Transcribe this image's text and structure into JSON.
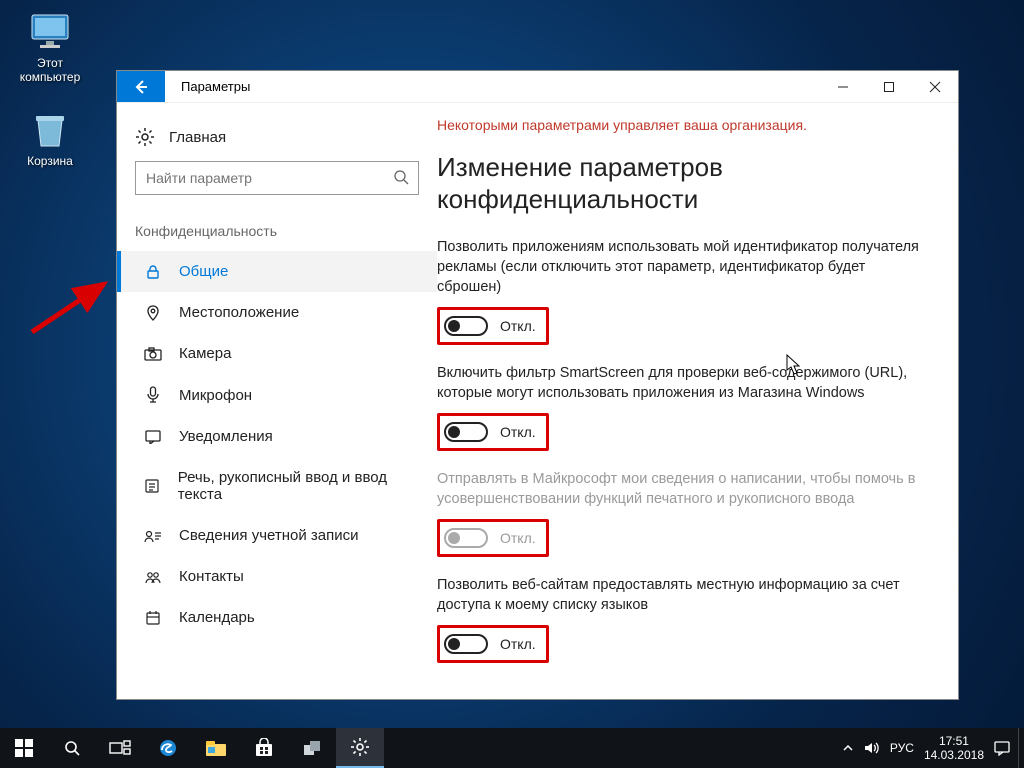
{
  "desktop": {
    "icons": [
      {
        "name": "this-pc",
        "label": "Этот\nкомпьютер"
      },
      {
        "name": "recycle-bin",
        "label": "Корзина"
      }
    ]
  },
  "window": {
    "title": "Параметры",
    "home": "Главная",
    "search_placeholder": "Найти параметр",
    "section": "Конфиденциальность",
    "nav": [
      {
        "key": "general",
        "label": "Общие",
        "active": true
      },
      {
        "key": "location",
        "label": "Местоположение"
      },
      {
        "key": "camera",
        "label": "Камера"
      },
      {
        "key": "mic",
        "label": "Микрофон"
      },
      {
        "key": "notif",
        "label": "Уведомления"
      },
      {
        "key": "speech",
        "label": "Речь, рукописный ввод и ввод текста"
      },
      {
        "key": "account",
        "label": "Сведения учетной записи"
      },
      {
        "key": "contacts",
        "label": "Контакты"
      },
      {
        "key": "calendar",
        "label": "Календарь"
      }
    ],
    "policy_note": "Некоторыми параметрами управляет ваша организация.",
    "heading": "Изменение параметров конфиденциальности",
    "toggles": [
      {
        "desc": "Позволить приложениям использовать мой идентификатор получателя рекламы (если отключить этот параметр, идентификатор будет сброшен)",
        "state": "Откл.",
        "on": false,
        "disabled": false
      },
      {
        "desc": "Включить фильтр SmartScreen для проверки веб-содержимого (URL), которые могут использовать приложения из Магазина Windows",
        "state": "Откл.",
        "on": false,
        "disabled": false
      },
      {
        "desc": "Отправлять в Майкрософт мои сведения о написании, чтобы помочь в усовершенствовании функций печатного и рукописного ввода",
        "state": "Откл.",
        "on": false,
        "disabled": true
      },
      {
        "desc": "Позволить веб-сайтам предоставлять местную информацию за счет доступа к моему списку языков",
        "state": "Откл.",
        "on": false,
        "disabled": false
      }
    ]
  },
  "taskbar": {
    "lang": "РУС",
    "time": "17:51",
    "date": "14.03.2018"
  }
}
